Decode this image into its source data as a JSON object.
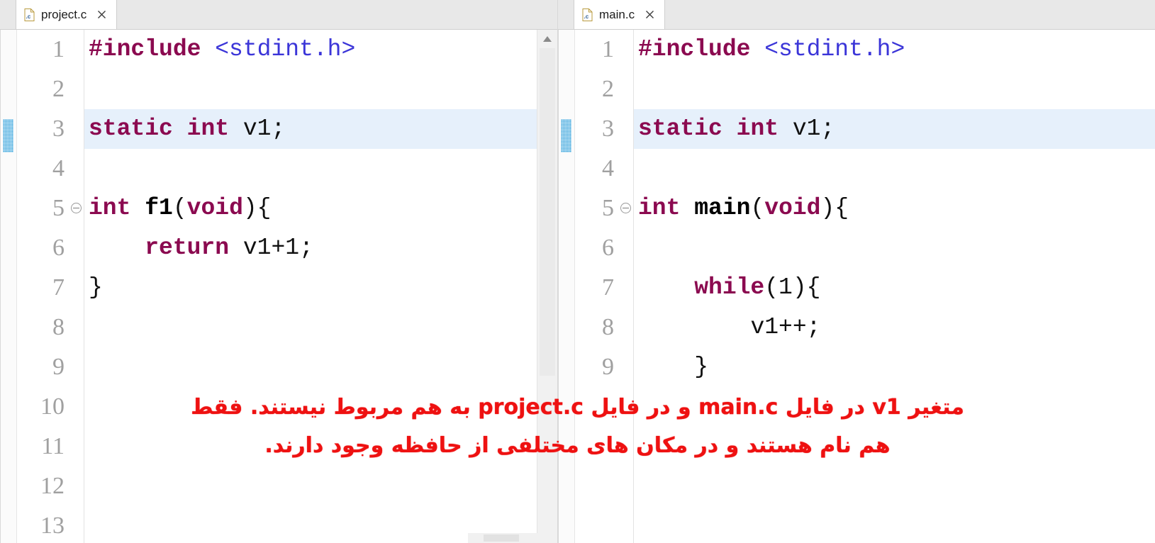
{
  "window": {
    "background": "#ffffff",
    "tabbar_background": "#e8e8e8"
  },
  "colors": {
    "keyword": "#8b0a50",
    "include_path": "#3b35d8",
    "function_name": "#000000",
    "plain": "#101010",
    "line_number": "#a0a0a0",
    "highlight_line": "#e6f0fb",
    "occurrence_marker": "#36a3dc",
    "annotation_red": "#ee1111"
  },
  "panes": [
    {
      "id": "left",
      "tab": {
        "label": "project.c",
        "icon": "c-file-icon",
        "close_icon": "close-icon",
        "active": true
      },
      "gutter": {
        "occurrence_marker_line": 3,
        "fold_markers": [
          5
        ]
      },
      "scrollbar": {
        "up_arrow_icon": "scroll-up-arrow-icon",
        "visible": true
      },
      "line_numbers": [
        "1",
        "2",
        "3",
        "4",
        "5",
        "6",
        "7",
        "8",
        "9",
        "10",
        "11",
        "12",
        "13"
      ],
      "highlighted_line": 3,
      "lines": [
        {
          "n": "1",
          "tokens": [
            {
              "t": "#include",
              "c": "pp"
            },
            {
              "t": " ",
              "c": "pl"
            },
            {
              "t": "<stdint.h>",
              "c": "inc"
            }
          ]
        },
        {
          "n": "2",
          "tokens": []
        },
        {
          "n": "3",
          "tokens": [
            {
              "t": "static",
              "c": "kw"
            },
            {
              "t": " ",
              "c": "pl"
            },
            {
              "t": "int",
              "c": "kw"
            },
            {
              "t": " ",
              "c": "pl"
            },
            {
              "t": "v1;",
              "c": "pl"
            }
          ]
        },
        {
          "n": "4",
          "tokens": []
        },
        {
          "n": "5",
          "tokens": [
            {
              "t": "int",
              "c": "kw"
            },
            {
              "t": " ",
              "c": "pl"
            },
            {
              "t": "f1",
              "c": "fn"
            },
            {
              "t": "(",
              "c": "pl"
            },
            {
              "t": "void",
              "c": "kw"
            },
            {
              "t": "){",
              "c": "pl"
            }
          ]
        },
        {
          "n": "6",
          "tokens": [
            {
              "t": "    ",
              "c": "pl"
            },
            {
              "t": "return",
              "c": "kw"
            },
            {
              "t": " ",
              "c": "pl"
            },
            {
              "t": "v1+1;",
              "c": "pl"
            }
          ]
        },
        {
          "n": "7",
          "tokens": [
            {
              "t": "}",
              "c": "pl"
            }
          ]
        },
        {
          "n": "8",
          "tokens": []
        },
        {
          "n": "9",
          "tokens": []
        },
        {
          "n": "10",
          "tokens": []
        },
        {
          "n": "11",
          "tokens": []
        },
        {
          "n": "12",
          "tokens": []
        },
        {
          "n": "13",
          "tokens": []
        }
      ]
    },
    {
      "id": "right",
      "tab": {
        "label": "main.c",
        "icon": "c-file-icon",
        "close_icon": "close-icon",
        "active": true
      },
      "gutter": {
        "occurrence_marker_line": 3,
        "fold_markers": [
          5
        ]
      },
      "scrollbar": {
        "up_arrow_icon": "scroll-up-arrow-icon",
        "visible": false
      },
      "line_numbers": [
        "1",
        "2",
        "3",
        "4",
        "5",
        "6",
        "7",
        "8",
        "9"
      ],
      "highlighted_line": 3,
      "lines": [
        {
          "n": "1",
          "tokens": [
            {
              "t": "#include",
              "c": "pp"
            },
            {
              "t": " ",
              "c": "pl"
            },
            {
              "t": "<stdint.h>",
              "c": "inc"
            }
          ]
        },
        {
          "n": "2",
          "tokens": []
        },
        {
          "n": "3",
          "tokens": [
            {
              "t": "static",
              "c": "kw"
            },
            {
              "t": " ",
              "c": "pl"
            },
            {
              "t": "int",
              "c": "kw"
            },
            {
              "t": " ",
              "c": "pl"
            },
            {
              "t": "v1;",
              "c": "pl"
            }
          ]
        },
        {
          "n": "4",
          "tokens": []
        },
        {
          "n": "5",
          "tokens": [
            {
              "t": "int",
              "c": "kw"
            },
            {
              "t": " ",
              "c": "pl"
            },
            {
              "t": "main",
              "c": "fn"
            },
            {
              "t": "(",
              "c": "pl"
            },
            {
              "t": "void",
              "c": "kw"
            },
            {
              "t": "){",
              "c": "pl"
            }
          ]
        },
        {
          "n": "6",
          "tokens": []
        },
        {
          "n": "7",
          "tokens": [
            {
              "t": "    ",
              "c": "pl"
            },
            {
              "t": "while",
              "c": "kw"
            },
            {
              "t": "(1){",
              "c": "pl"
            }
          ]
        },
        {
          "n": "8",
          "tokens": [
            {
              "t": "        ",
              "c": "pl"
            },
            {
              "t": "v1++;",
              "c": "pl"
            }
          ]
        },
        {
          "n": "9",
          "tokens": [
            {
              "t": "    ",
              "c": "pl"
            },
            {
              "t": "}",
              "c": "pl"
            }
          ]
        }
      ]
    }
  ],
  "annotation": {
    "color": "#ee1111",
    "lines": [
      "متغیر v1 در فایل main.c و در فایل project.c به هم مربوط نیستند. فقط",
      "هم نام هستند و در مکان های مختلفی از حافظه وجود دارند."
    ]
  }
}
